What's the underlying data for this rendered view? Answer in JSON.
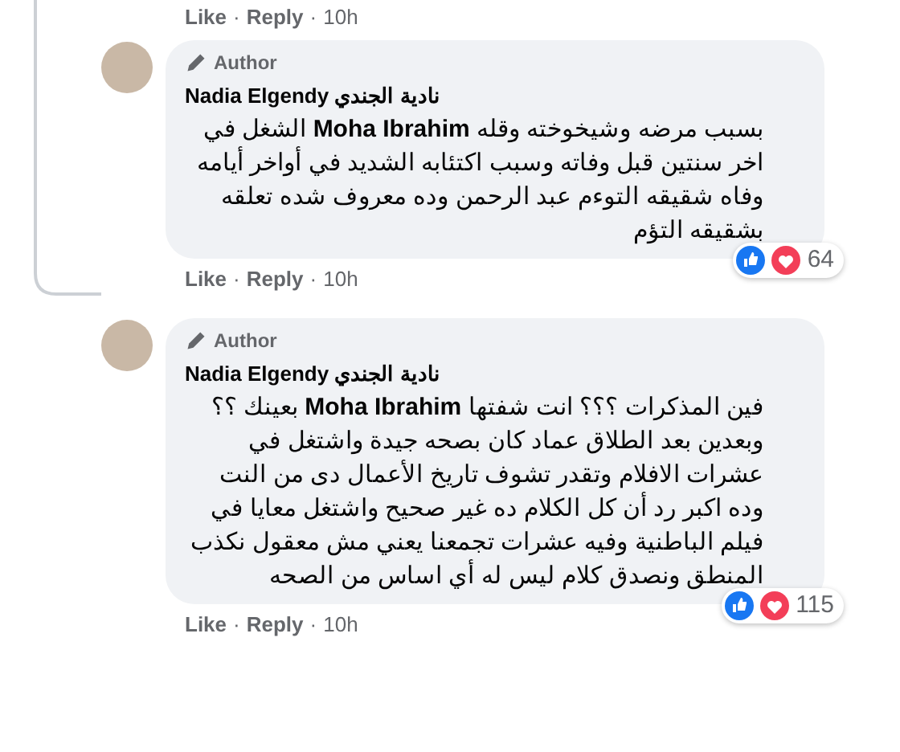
{
  "previous_actions": {
    "like": "Like",
    "separator": "·",
    "reply": "Reply",
    "time": "10h"
  },
  "comments": [
    {
      "badge": "Author",
      "author": "Nadia Elgendy نادية الجندي",
      "text": "بسبب مرضه وشيخوخته وقله **Moha Ibrahim** الشغل في اخر سنتين قبل وفاته وسبب اكتئابه الشديد في أواخر أيامه وفاه شقيقه التوءم عبد الرحمن وده معروف شده تعلقه بشقيقه التؤم",
      "reaction_count": "64",
      "like": "Like",
      "separator": "·",
      "reply": "Reply",
      "time": "10h"
    },
    {
      "badge": "Author",
      "author": "Nadia Elgendy نادية الجندي",
      "text": "فين المذكرات ؟؟؟ انت شفتها **Moha Ibrahim** بعينك ؟؟ وبعدين بعد الطلاق عماد كان بصحه جيدة واشتغل في عشرات الافلام وتقدر تشوف تاريخ الأعمال دى من النت وده اكبر رد أن كل الكلام ده غير صحيح واشتغل معايا في فيلم الباطنية وفيه عشرات تجمعنا يعني مش معقول نكذب المنطق ونصدق كلام ليس له أي اساس من الصحه",
      "reaction_count": "115",
      "like": "Like",
      "separator": "·",
      "reply": "Reply",
      "time": "10h"
    }
  ]
}
